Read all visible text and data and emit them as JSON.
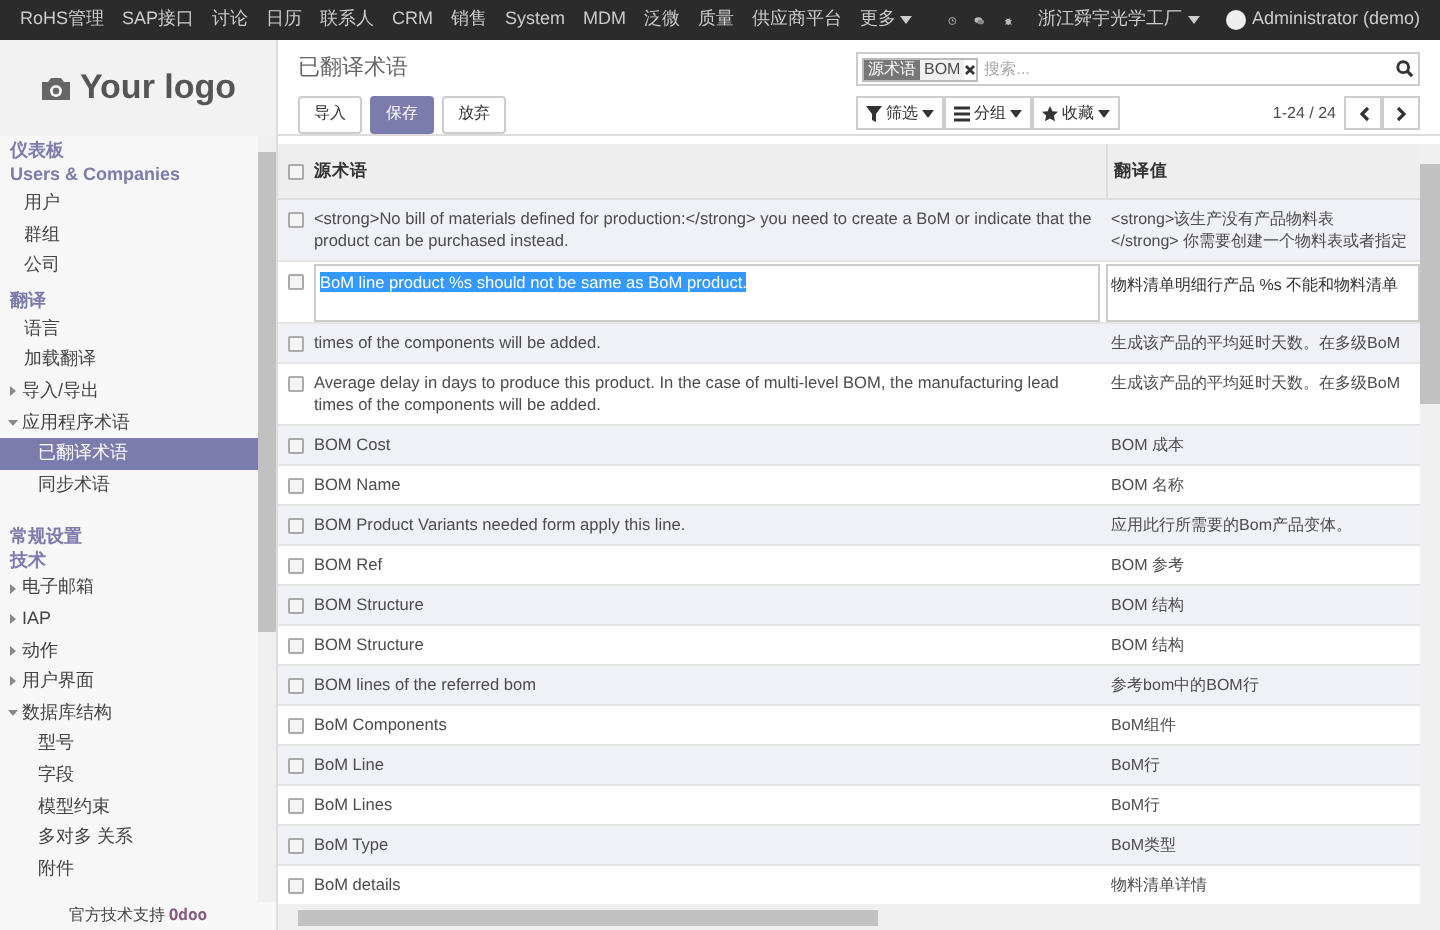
{
  "top_menu": [
    {
      "label": "RoHS管理",
      "caret": false
    },
    {
      "label": "SAP接口",
      "caret": false
    },
    {
      "label": "讨论",
      "caret": false
    },
    {
      "label": "日历",
      "caret": false
    },
    {
      "label": "联系人",
      "caret": false
    },
    {
      "label": "CRM",
      "caret": false
    },
    {
      "label": "销售",
      "caret": false
    },
    {
      "label": "System",
      "caret": false
    },
    {
      "label": "MDM",
      "caret": false
    },
    {
      "label": "泛微",
      "caret": false
    },
    {
      "label": "质量",
      "caret": false
    },
    {
      "label": "供应商平台",
      "caret": false
    },
    {
      "label": "更多",
      "caret": true
    }
  ],
  "systray": {
    "company": "浙江舜宇光学工厂",
    "user": "Administrator (demo)"
  },
  "logo": {
    "text": "Your logo"
  },
  "sidebar": {
    "sections": [
      {
        "title": "仪表板"
      },
      {
        "title": "Users & Companies",
        "items": [
          {
            "label": "用户",
            "kind": "leaf",
            "selected": false
          },
          {
            "label": "群组",
            "kind": "leaf",
            "selected": false
          },
          {
            "label": "公司",
            "kind": "leaf",
            "selected": false
          }
        ]
      },
      {
        "title": "翻译",
        "items": [
          {
            "label": "语言",
            "kind": "leaf",
            "selected": false
          },
          {
            "label": "加载翻译",
            "kind": "leaf",
            "selected": false
          },
          {
            "label": "导入/导出",
            "kind": "folder",
            "expanded": false
          },
          {
            "label": "应用程序术语",
            "kind": "folder",
            "expanded": true,
            "children": [
              {
                "label": "已翻译术语",
                "kind": "leaf",
                "selected": true
              },
              {
                "label": "同步术语",
                "kind": "leaf",
                "selected": false
              }
            ]
          }
        ]
      },
      {
        "title": "常规设置"
      },
      {
        "title": "技术",
        "items": [
          {
            "label": "电子邮箱",
            "kind": "folder",
            "expanded": false
          },
          {
            "label": "IAP",
            "kind": "folder",
            "expanded": false
          },
          {
            "label": "动作",
            "kind": "folder",
            "expanded": false
          },
          {
            "label": "用户界面",
            "kind": "folder",
            "expanded": false
          },
          {
            "label": "数据库结构",
            "kind": "folder",
            "expanded": true,
            "children": [
              {
                "label": "型号",
                "kind": "leaf",
                "selected": false
              },
              {
                "label": "字段",
                "kind": "leaf",
                "selected": false
              },
              {
                "label": "模型约束",
                "kind": "leaf",
                "selected": false
              },
              {
                "label": "多对多 关系",
                "kind": "leaf",
                "selected": false
              },
              {
                "label": "附件",
                "kind": "leaf",
                "selected": false
              }
            ]
          }
        ]
      }
    ],
    "footer": {
      "text": "官方技术支持",
      "brand": "Odoo"
    }
  },
  "control_panel": {
    "breadcrumb": "已翻译术语",
    "buttons": [
      {
        "label": "导入",
        "kind": "default"
      },
      {
        "label": "保存",
        "kind": "primary"
      },
      {
        "label": "放弃",
        "kind": "default"
      }
    ],
    "search": {
      "facets": [
        {
          "category": "源术语",
          "value": "BOM"
        }
      ],
      "placeholder": "搜索..."
    },
    "filters": [
      {
        "label": "筛选",
        "kind": "filter"
      },
      {
        "label": "分组",
        "kind": "groupby"
      },
      {
        "label": "收藏",
        "kind": "favorites"
      }
    ],
    "pager": "1-24 / 24"
  },
  "table": {
    "all_checked": false,
    "columns": [
      "源术语",
      "翻译值"
    ],
    "rows": [
      {
        "source": "<strong>No bill of materials defined for production:</strong> you need to create a BoM or indicate that the product can be purchased instead.",
        "translation": "<strong>该生产没有产品物料表\n</strong> 你需要创建一个物料表或者指定",
        "editing": false,
        "checked": false
      },
      {
        "source": "BoM line product %s should not be same as BoM product.",
        "translation": "物料清单明细行产品 %s 不能和物料清单",
        "editing": true,
        "checked": false
      },
      {
        "source": "times of the components will be added.",
        "translation": "生成该产品的平均延时天数。在多级BoM",
        "editing": false,
        "checked": false
      },
      {
        "source": "Average delay in days to produce this product. In the case of multi-level BOM, the manufacturing lead times of the components will be added.",
        "translation": "生成该产品的平均延时天数。在多级BoM",
        "editing": false,
        "checked": false
      },
      {
        "source": "BOM Cost",
        "translation": "BOM 成本",
        "editing": false,
        "checked": false
      },
      {
        "source": "BOM Name",
        "translation": "BOM 名称",
        "editing": false,
        "checked": false
      },
      {
        "source": "BOM Product Variants needed form apply this line.",
        "translation": "应用此行所需要的Bom产品变体。",
        "editing": false,
        "checked": false
      },
      {
        "source": "BOM Ref",
        "translation": "BOM 参考",
        "editing": false,
        "checked": false
      },
      {
        "source": "BOM Structure",
        "translation": "BOM 结构",
        "editing": false,
        "checked": false
      },
      {
        "source": "BOM Structure",
        "translation": "BOM 结构",
        "editing": false,
        "checked": false
      },
      {
        "source": "BOM lines of the referred bom",
        "translation": "参考bom中的BOM行",
        "editing": false,
        "checked": false
      },
      {
        "source": "BoM Components",
        "translation": "BoM组件",
        "editing": false,
        "checked": false
      },
      {
        "source": "BoM Line",
        "translation": "BoM行",
        "editing": false,
        "checked": false
      },
      {
        "source": "BoM Lines",
        "translation": "BoM行",
        "editing": false,
        "checked": false
      },
      {
        "source": "BoM Type",
        "translation": "BoM类型",
        "editing": false,
        "checked": false
      },
      {
        "source": "BoM details",
        "translation": "物料清单详情",
        "editing": false,
        "checked": false
      }
    ]
  }
}
